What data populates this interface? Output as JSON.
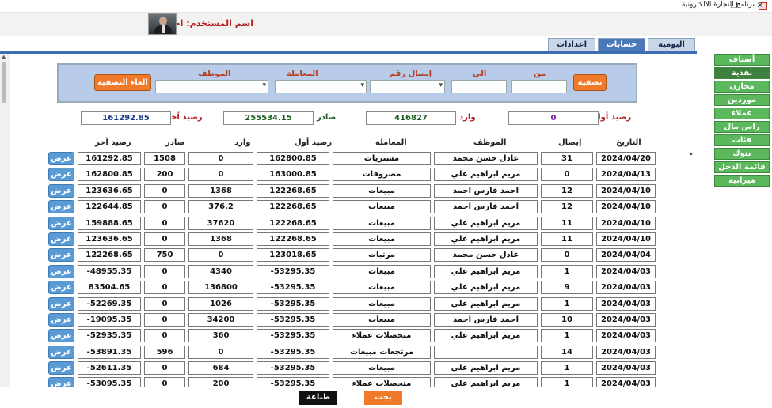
{
  "window": {
    "title": "برنامج التجارة الالكترونية",
    "restore": "❐",
    "close": "✕"
  },
  "header": {
    "user_label": "اسم المستخدم: احمد"
  },
  "tabs": [
    "اليومية",
    "حسابات",
    "اعدادات"
  ],
  "sidebar": [
    "أصناف",
    "نقدية",
    "مخازن",
    "موردين",
    "عملاء",
    "راس مال",
    "فئات",
    "بنوك",
    "قائمة الدخل",
    "ميزانية"
  ],
  "filter": {
    "from_label": "من",
    "to_label": "الى",
    "receipt_label": "إيصال رقم",
    "transaction_label": "المعاملة",
    "employee_label": "الموظف",
    "filter_button": "تصفية",
    "clear_button": "الغاء التصفية"
  },
  "summary": {
    "opening_label": "رصيد أول",
    "opening_value": "0",
    "incoming_label": "وارد",
    "incoming_value": "416827",
    "outgoing_label": "صادر",
    "outgoing_value": "255534.15",
    "closing_label": "رصيد آخر",
    "closing_value": "161292.85"
  },
  "columns": [
    "التاريخ",
    "إيصال",
    "الموظف",
    "المعاملة",
    "رصيد أول",
    "وارد",
    "صادر",
    "رصيد آخر"
  ],
  "view_label": "عرض",
  "rows": [
    [
      "2024/04/20",
      "31",
      "عادل حسن محمد",
      "مشتريات",
      "162800.85",
      "0",
      "1508",
      "161292.85"
    ],
    [
      "2024/04/13",
      "0",
      "مريم ابراهيم علي",
      "مصروفات",
      "163000.85",
      "0",
      "200",
      "162800.85"
    ],
    [
      "2024/04/10",
      "12",
      "احمد فارس احمد",
      "مبيعات",
      "122268.65",
      "1368",
      "0",
      "123636.65"
    ],
    [
      "2024/04/10",
      "12",
      "احمد فارس احمد",
      "مبيعات",
      "122268.65",
      "376.2",
      "0",
      "122644.85"
    ],
    [
      "2024/04/10",
      "11",
      "مريم ابراهيم علي",
      "مبيعات",
      "122268.65",
      "37620",
      "0",
      "159888.65"
    ],
    [
      "2024/04/10",
      "11",
      "مريم ابراهيم علي",
      "مبيعات",
      "122268.65",
      "1368",
      "0",
      "123636.65"
    ],
    [
      "2024/04/04",
      "0",
      "عادل حسن محمد",
      "مرتبات",
      "123018.65",
      "0",
      "750",
      "122268.65"
    ],
    [
      "2024/04/03",
      "1",
      "مريم ابراهيم علي",
      "مبيعات",
      "-53295.35",
      "4340",
      "0",
      "-48955.35"
    ],
    [
      "2024/04/03",
      "9",
      "مريم ابراهيم علي",
      "مبيعات",
      "-53295.35",
      "136800",
      "0",
      "83504.65"
    ],
    [
      "2024/04/03",
      "1",
      "مريم ابراهيم علي",
      "مبيعات",
      "-53295.35",
      "1026",
      "0",
      "-52269.35"
    ],
    [
      "2024/04/03",
      "10",
      "احمد فارس احمد",
      "مبيعات",
      "-53295.35",
      "34200",
      "0",
      "-19095.35"
    ],
    [
      "2024/04/03",
      "1",
      "مريم ابراهيم علي",
      "متحصلات عملاء",
      "-53295.35",
      "360",
      "0",
      "-52935.35"
    ],
    [
      "2024/04/03",
      "14",
      "",
      "مرتجعات مبيعات",
      "-53295.35",
      "0",
      "596",
      "-53891.35"
    ],
    [
      "2024/04/03",
      "1",
      "مريم ابراهيم علي",
      "مبيعات",
      "-53295.35",
      "684",
      "0",
      "-52611.35"
    ],
    [
      "2024/04/03",
      "1",
      "مريم ابراهيم علي",
      "متحصلات عملاء",
      "-53295.35",
      "200",
      "0",
      "-53095.35"
    ]
  ],
  "bottom": {
    "print_button": "طباعة",
    "search_button": "بحث"
  },
  "colors": {
    "accent_orange": "#f07a2a",
    "tab_active": "#4b79b8",
    "sidebar_green": "#5cb85c",
    "label_red": "#b71c1c"
  }
}
